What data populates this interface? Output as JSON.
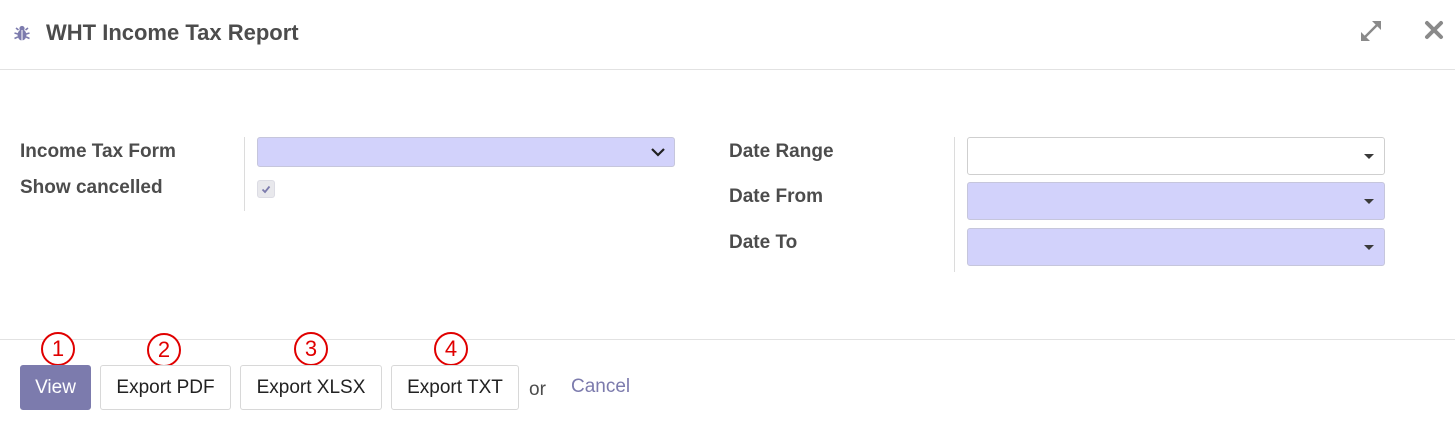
{
  "dialog": {
    "title": "WHT Income Tax Report"
  },
  "form": {
    "income_tax_form": {
      "label": "Income Tax Form",
      "value": ""
    },
    "show_cancelled": {
      "label": "Show cancelled",
      "checked": true
    },
    "date_range": {
      "label": "Date Range",
      "value": ""
    },
    "date_from": {
      "label": "Date From",
      "value": ""
    },
    "date_to": {
      "label": "Date To",
      "value": ""
    }
  },
  "footer": {
    "view_label": "View",
    "export_pdf_label": "Export PDF",
    "export_xlsx_label": "Export XLSX",
    "export_txt_label": "Export TXT",
    "or_text": "or",
    "cancel_label": "Cancel"
  },
  "markers": [
    "1",
    "2",
    "3",
    "4"
  ],
  "colors": {
    "primary": "#7c7bad",
    "required_field": "#d2d2fb",
    "marker": "#e00000"
  },
  "icons": {
    "header_left": "bug-icon",
    "expand": "expand-icon",
    "close": "close-icon"
  }
}
